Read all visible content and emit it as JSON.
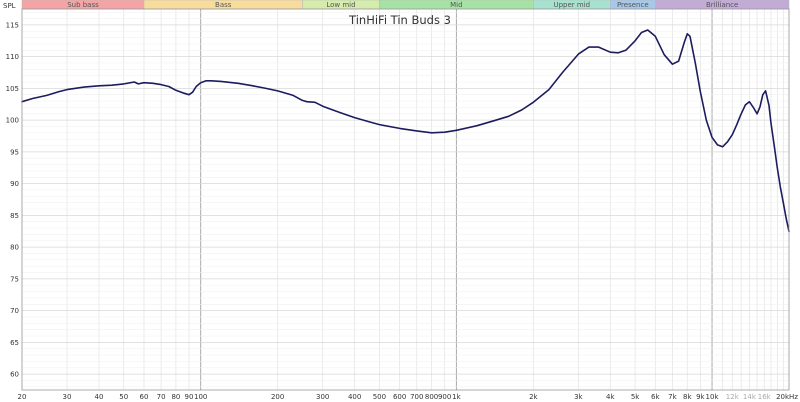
{
  "chart_data": {
    "type": "line",
    "title": "TinHiFi Tin Buds 3",
    "ylabel": "SPL",
    "x_unit": "Hz",
    "x_scale": "log",
    "xlim": [
      20,
      20000
    ],
    "ylim": [
      57.5,
      117.5
    ],
    "grid": true,
    "bands": [
      {
        "label": "Sub bass",
        "from": 20,
        "to": 60,
        "color": "#f4a4a4"
      },
      {
        "label": "Bass",
        "from": 60,
        "to": 250,
        "color": "#f7dc9c"
      },
      {
        "label": "Low mid",
        "from": 250,
        "to": 500,
        "color": "#d6ecac"
      },
      {
        "label": "Mid",
        "from": 500,
        "to": 2000,
        "color": "#a6e2a4"
      },
      {
        "label": "Upper mid",
        "from": 2000,
        "to": 4000,
        "color": "#a6e2cf"
      },
      {
        "label": "Presence",
        "from": 4000,
        "to": 6000,
        "color": "#a7c8ea"
      },
      {
        "label": "Brilliance",
        "from": 6000,
        "to": 20000,
        "color": "#c3abd8"
      }
    ],
    "x_ticks": [
      {
        "value": 20,
        "label": "20"
      },
      {
        "value": 30,
        "label": "30"
      },
      {
        "value": 40,
        "label": "40"
      },
      {
        "value": 50,
        "label": "50"
      },
      {
        "value": 60,
        "label": "60"
      },
      {
        "value": 70,
        "label": "70"
      },
      {
        "value": 80,
        "label": "80"
      },
      {
        "value": 90,
        "label": "90"
      },
      {
        "value": 100,
        "label": "100"
      },
      {
        "value": 200,
        "label": "200"
      },
      {
        "value": 300,
        "label": "300"
      },
      {
        "value": 400,
        "label": "400"
      },
      {
        "value": 500,
        "label": "500"
      },
      {
        "value": 600,
        "label": "600"
      },
      {
        "value": 700,
        "label": "700"
      },
      {
        "value": 800,
        "label": "800"
      },
      {
        "value": 900,
        "label": "900"
      },
      {
        "value": 1000,
        "label": "1k"
      },
      {
        "value": 2000,
        "label": "2k"
      },
      {
        "value": 3000,
        "label": "3k"
      },
      {
        "value": 4000,
        "label": "4k"
      },
      {
        "value": 5000,
        "label": "5k"
      },
      {
        "value": 6000,
        "label": "6k"
      },
      {
        "value": 7000,
        "label": "7k"
      },
      {
        "value": 8000,
        "label": "8k"
      },
      {
        "value": 9000,
        "label": "9k"
      },
      {
        "value": 10000,
        "label": "10k"
      },
      {
        "value": 12000,
        "label": "12k",
        "faint": true
      },
      {
        "value": 14000,
        "label": "14k",
        "faint": true
      },
      {
        "value": 16000,
        "label": "16k",
        "faint": true
      },
      {
        "value": 20000,
        "label": "20kHz"
      }
    ],
    "y_ticks": [
      60,
      65,
      70,
      75,
      80,
      85,
      90,
      95,
      100,
      105,
      110,
      115
    ],
    "series": [
      {
        "color": "#1c1c5e",
        "points": [
          [
            20,
            102.9
          ],
          [
            22,
            103.4
          ],
          [
            25,
            103.9
          ],
          [
            28,
            104.5
          ],
          [
            30,
            104.8
          ],
          [
            35,
            105.2
          ],
          [
            40,
            105.4
          ],
          [
            45,
            105.5
          ],
          [
            50,
            105.7
          ],
          [
            55,
            106.0
          ],
          [
            57,
            105.7
          ],
          [
            60,
            105.9
          ],
          [
            65,
            105.8
          ],
          [
            70,
            105.6
          ],
          [
            75,
            105.3
          ],
          [
            80,
            104.7
          ],
          [
            85,
            104.3
          ],
          [
            90,
            104.0
          ],
          [
            93,
            104.4
          ],
          [
            96,
            105.3
          ],
          [
            100,
            105.9
          ],
          [
            105,
            106.2
          ],
          [
            110,
            106.2
          ],
          [
            120,
            106.1
          ],
          [
            140,
            105.8
          ],
          [
            160,
            105.4
          ],
          [
            180,
            105.0
          ],
          [
            200,
            104.6
          ],
          [
            230,
            103.9
          ],
          [
            250,
            103.1
          ],
          [
            260,
            102.9
          ],
          [
            280,
            102.8
          ],
          [
            300,
            102.2
          ],
          [
            350,
            101.2
          ],
          [
            400,
            100.4
          ],
          [
            450,
            99.8
          ],
          [
            500,
            99.3
          ],
          [
            600,
            98.7
          ],
          [
            700,
            98.3
          ],
          [
            800,
            98.0
          ],
          [
            900,
            98.1
          ],
          [
            1000,
            98.4
          ],
          [
            1200,
            99.1
          ],
          [
            1400,
            99.9
          ],
          [
            1600,
            100.6
          ],
          [
            1800,
            101.6
          ],
          [
            2000,
            102.8
          ],
          [
            2300,
            104.8
          ],
          [
            2600,
            107.5
          ],
          [
            3000,
            110.4
          ],
          [
            3300,
            111.5
          ],
          [
            3600,
            111.5
          ],
          [
            4000,
            110.7
          ],
          [
            4300,
            110.6
          ],
          [
            4600,
            111.0
          ],
          [
            5000,
            112.5
          ],
          [
            5300,
            113.8
          ],
          [
            5600,
            114.2
          ],
          [
            6000,
            113.2
          ],
          [
            6500,
            110.3
          ],
          [
            7000,
            108.8
          ],
          [
            7400,
            109.3
          ],
          [
            7800,
            112.3
          ],
          [
            8000,
            113.6
          ],
          [
            8200,
            113.2
          ],
          [
            8600,
            109.0
          ],
          [
            9000,
            104.5
          ],
          [
            9500,
            100.0
          ],
          [
            10000,
            97.3
          ],
          [
            10500,
            96.1
          ],
          [
            11000,
            95.8
          ],
          [
            11500,
            96.6
          ],
          [
            12000,
            97.7
          ],
          [
            12500,
            99.3
          ],
          [
            13000,
            101.0
          ],
          [
            13500,
            102.4
          ],
          [
            14000,
            102.9
          ],
          [
            14500,
            102.0
          ],
          [
            15000,
            101.0
          ],
          [
            15400,
            102.1
          ],
          [
            15800,
            104.0
          ],
          [
            16200,
            104.6
          ],
          [
            16700,
            102.3
          ],
          [
            17000,
            99.5
          ],
          [
            17500,
            96.0
          ],
          [
            18000,
            92.5
          ],
          [
            18500,
            89.5
          ],
          [
            19000,
            87.0
          ],
          [
            19500,
            84.5
          ],
          [
            20000,
            82.5
          ]
        ]
      }
    ]
  }
}
